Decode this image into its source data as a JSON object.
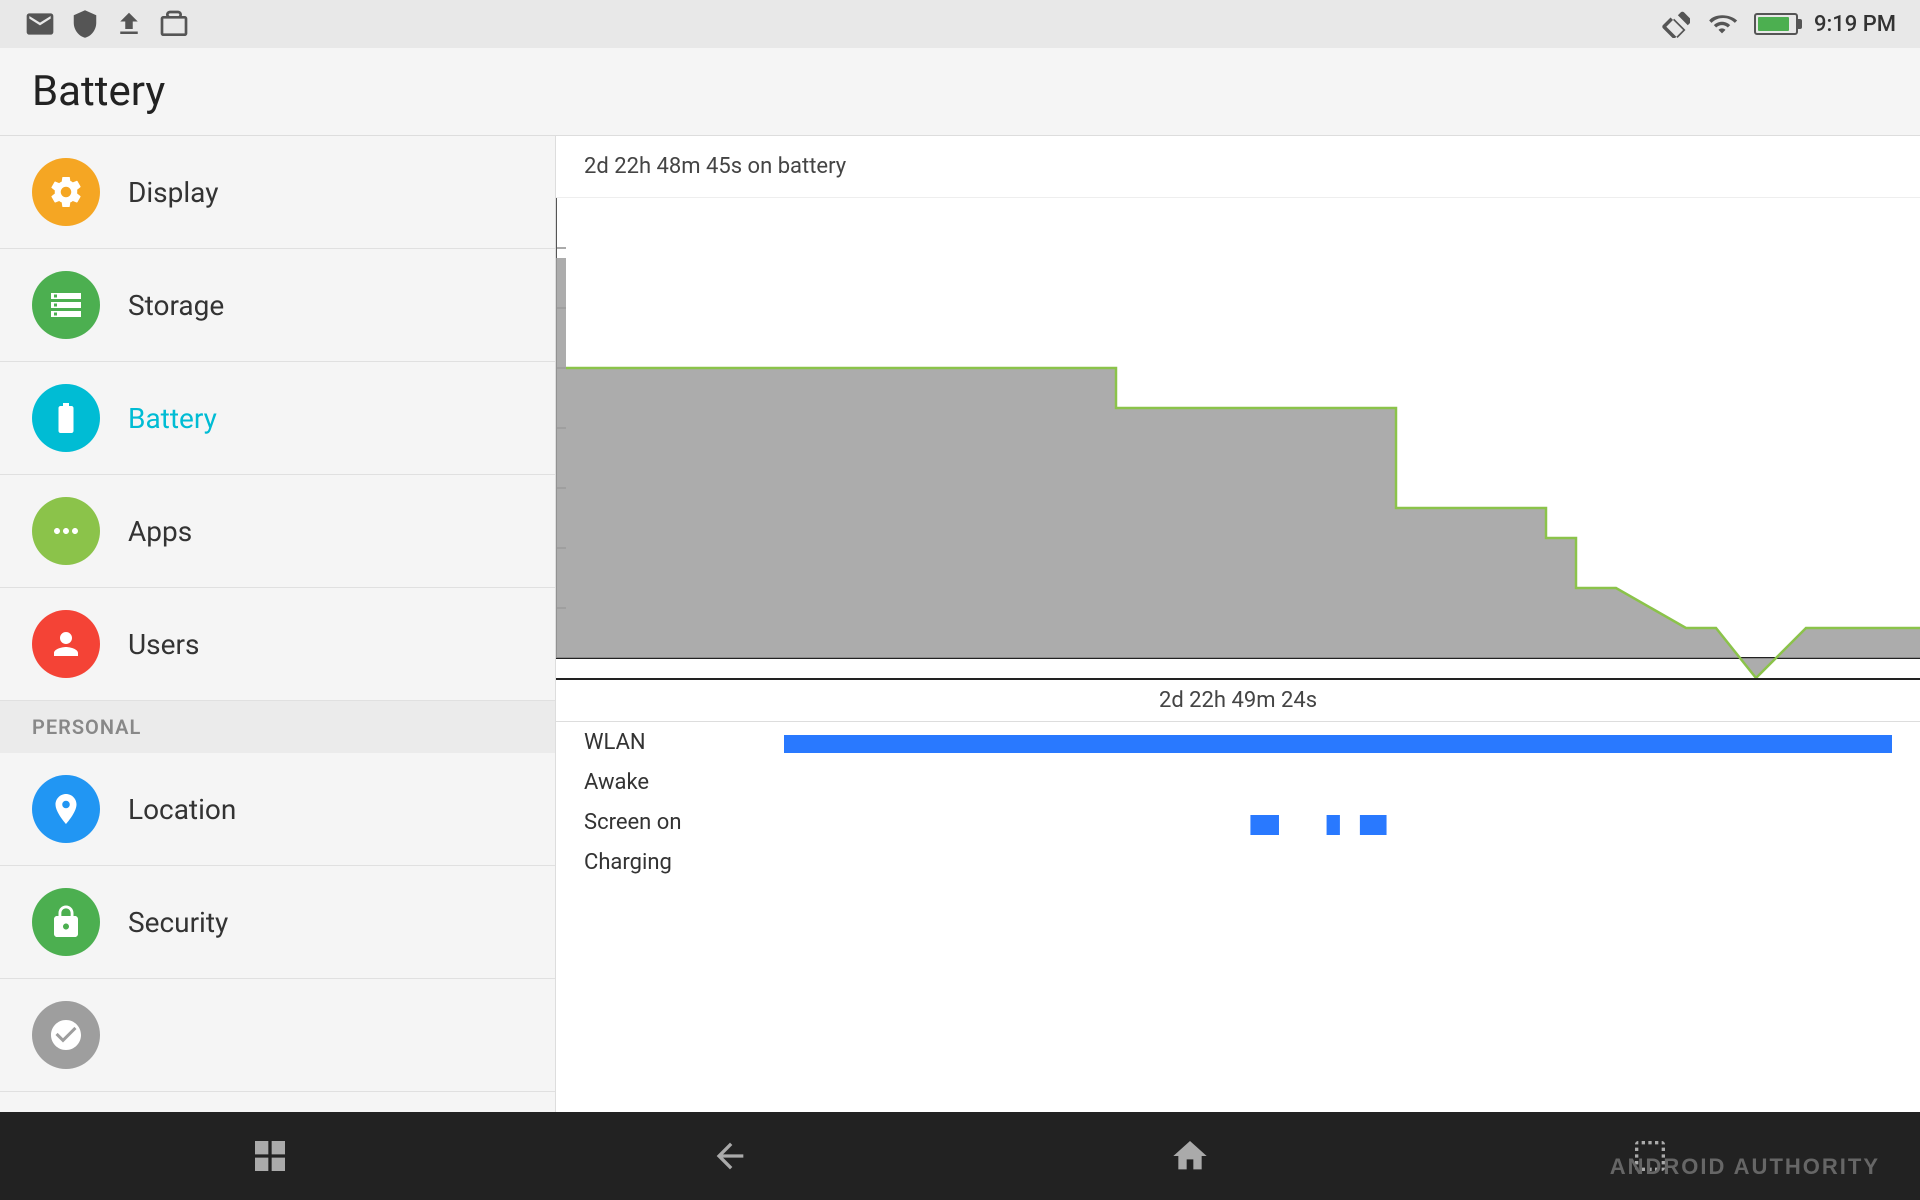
{
  "statusBar": {
    "time": "9:19 PM",
    "icons": [
      "gmail-icon",
      "shield-icon",
      "upload-icon",
      "briefcase-icon"
    ],
    "rightIcons": [
      "screen-rotation-icon",
      "wifi-icon",
      "battery-icon"
    ]
  },
  "pageTitle": "Battery",
  "sidebar": {
    "items": [
      {
        "id": "display",
        "label": "Display",
        "iconColor": "#f5a623",
        "iconType": "settings"
      },
      {
        "id": "storage",
        "label": "Storage",
        "iconColor": "#4caf50",
        "iconType": "storage"
      },
      {
        "id": "battery",
        "label": "Battery",
        "iconColor": "#00bcd4",
        "iconType": "battery",
        "active": true
      },
      {
        "id": "apps",
        "label": "Apps",
        "iconColor": "#8bc34a",
        "iconType": "apps"
      },
      {
        "id": "users",
        "label": "Users",
        "iconColor": "#f44336",
        "iconType": "users"
      }
    ],
    "personalSection": {
      "header": "PERSONAL",
      "items": [
        {
          "id": "location",
          "label": "Location",
          "iconColor": "#2196f3",
          "iconType": "location"
        },
        {
          "id": "security",
          "label": "Security",
          "iconColor": "#4caf50",
          "iconType": "security"
        }
      ]
    }
  },
  "battery": {
    "durationLabel": "2d 22h 48m 45s on battery",
    "timelineLabel": "2d 22h 49m 24s",
    "wlanLabel": "WLAN",
    "awakeLabel": "Awake",
    "screenOnLabel": "Screen on",
    "chargingLabel": "Charging"
  },
  "navBar": {
    "brandText": "ANDROID AUTHORITY"
  }
}
